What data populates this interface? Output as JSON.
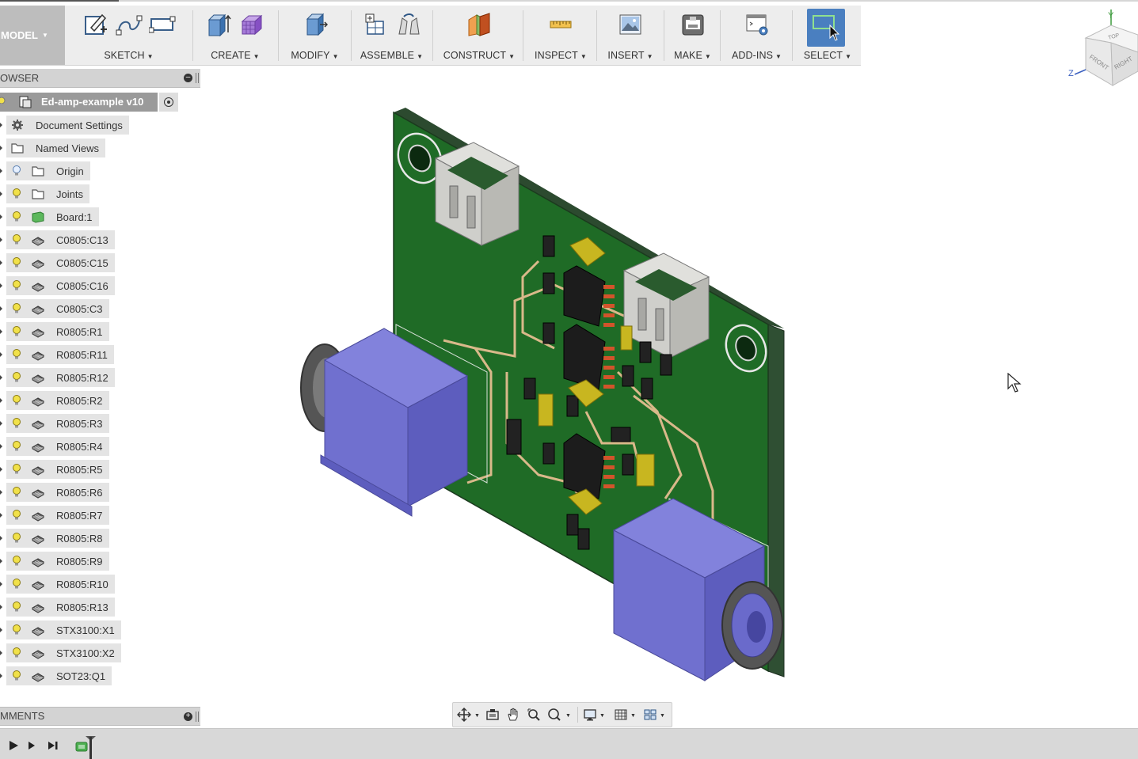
{
  "toolbar": {
    "workspace": "MODEL",
    "groups": [
      {
        "label": "SKETCH",
        "icons": [
          "sketch-create-icon",
          "spline-icon",
          "rectangle-icon"
        ]
      },
      {
        "label": "CREATE",
        "icons": [
          "extrude-icon",
          "form-icon"
        ]
      },
      {
        "label": "MODIFY",
        "icons": [
          "press-pull-icon"
        ]
      },
      {
        "label": "ASSEMBLE",
        "icons": [
          "new-component-icon",
          "joint-icon"
        ]
      },
      {
        "label": "CONSTRUCT",
        "icons": [
          "plane-icon"
        ]
      },
      {
        "label": "INSPECT",
        "icons": [
          "measure-icon"
        ]
      },
      {
        "label": "INSERT",
        "icons": [
          "insert-image-icon"
        ]
      },
      {
        "label": "MAKE",
        "icons": [
          "3d-print-icon"
        ]
      },
      {
        "label": "ADD-INS",
        "icons": [
          "scripts-icon"
        ]
      },
      {
        "label": "SELECT",
        "icons": [
          "select-icon"
        ]
      }
    ]
  },
  "browser": {
    "title": "OWSER",
    "root": "Ed-amp-example v10",
    "items": [
      {
        "label": "Document Settings",
        "icon": "gear-icon",
        "bulb": false
      },
      {
        "label": "Named Views",
        "icon": "folder-icon",
        "bulb": false
      },
      {
        "label": "Origin",
        "icon": "folder-icon",
        "bulb": "off"
      },
      {
        "label": "Joints",
        "icon": "folder-icon",
        "bulb": "on"
      },
      {
        "label": "Board:1",
        "icon": "body-icon",
        "bulb": "on"
      },
      {
        "label": "C0805:C13",
        "icon": "component-icon",
        "bulb": "on"
      },
      {
        "label": "C0805:C15",
        "icon": "component-icon",
        "bulb": "on"
      },
      {
        "label": "C0805:C16",
        "icon": "component-icon",
        "bulb": "on"
      },
      {
        "label": "C0805:C3",
        "icon": "component-icon",
        "bulb": "on"
      },
      {
        "label": "R0805:R1",
        "icon": "component-icon",
        "bulb": "on"
      },
      {
        "label": "R0805:R11",
        "icon": "component-icon",
        "bulb": "on"
      },
      {
        "label": "R0805:R12",
        "icon": "component-icon",
        "bulb": "on"
      },
      {
        "label": "R0805:R2",
        "icon": "component-icon",
        "bulb": "on"
      },
      {
        "label": "R0805:R3",
        "icon": "component-icon",
        "bulb": "on"
      },
      {
        "label": "R0805:R4",
        "icon": "component-icon",
        "bulb": "on"
      },
      {
        "label": "R0805:R5",
        "icon": "component-icon",
        "bulb": "on"
      },
      {
        "label": "R0805:R6",
        "icon": "component-icon",
        "bulb": "on"
      },
      {
        "label": "R0805:R7",
        "icon": "component-icon",
        "bulb": "on"
      },
      {
        "label": "R0805:R8",
        "icon": "component-icon",
        "bulb": "on"
      },
      {
        "label": "R0805:R9",
        "icon": "component-icon",
        "bulb": "on"
      },
      {
        "label": "R0805:R10",
        "icon": "component-icon",
        "bulb": "on"
      },
      {
        "label": "R0805:R13",
        "icon": "component-icon",
        "bulb": "on"
      },
      {
        "label": "STX3100:X1",
        "icon": "component-icon",
        "bulb": "on"
      },
      {
        "label": "STX3100:X2",
        "icon": "component-icon",
        "bulb": "on"
      },
      {
        "label": "SOT23:Q1",
        "icon": "component-icon",
        "bulb": "on"
      }
    ]
  },
  "comments": {
    "title": "MMENTS"
  },
  "viewcube": {
    "top": "TOP",
    "front": "FRONT",
    "right": "RIGHT",
    "axis_y": "Y",
    "axis_z": "Z"
  },
  "colors": {
    "board": "#1f6b26",
    "jack": "#6e6ed0",
    "accent": "#4a7fc0"
  }
}
